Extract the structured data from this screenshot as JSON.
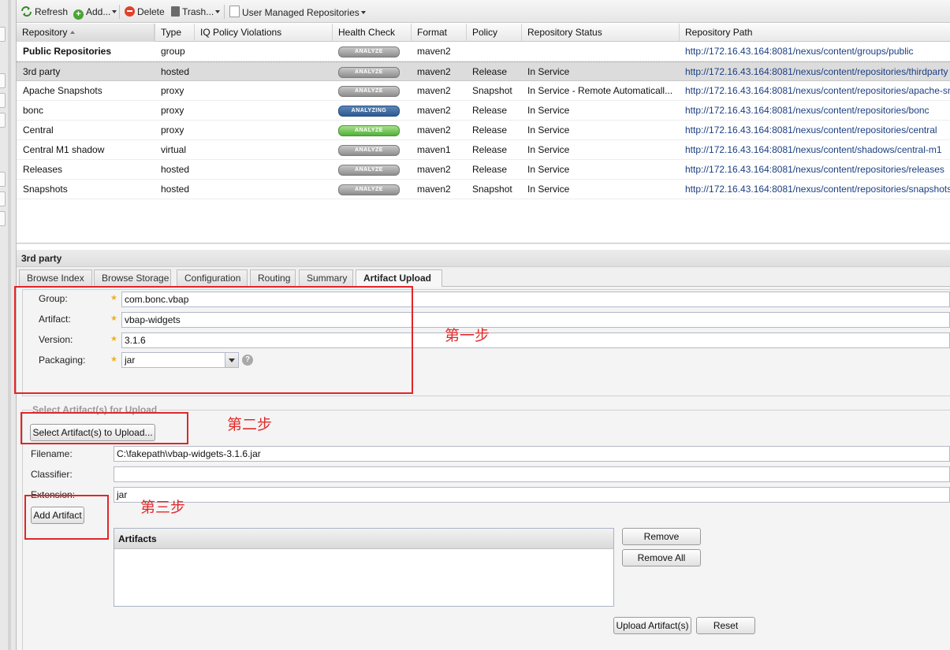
{
  "toolbar": {
    "refresh": "Refresh",
    "add": "Add...",
    "delete": "Delete",
    "trash": "Trash...",
    "filter": "User Managed Repositories"
  },
  "grid": {
    "columns": [
      "Repository",
      "Type",
      "IQ Policy Violations",
      "Health Check",
      "Format",
      "Policy",
      "Repository Status",
      "Repository Path"
    ],
    "rows": [
      {
        "name": "Public Repositories",
        "type": "group",
        "health": "ANALYZE",
        "health_style": "gray",
        "format": "maven2",
        "policy": "",
        "status": "",
        "path": "http://172.16.43.164:8081/nexus/content/groups/public"
      },
      {
        "name": "3rd party",
        "type": "hosted",
        "health": "ANALYZE",
        "health_style": "gray",
        "format": "maven2",
        "policy": "Release",
        "status": "In Service",
        "path": "http://172.16.43.164:8081/nexus/content/repositories/thirdparty"
      },
      {
        "name": "Apache Snapshots",
        "type": "proxy",
        "health": "ANALYZE",
        "health_style": "gray",
        "format": "maven2",
        "policy": "Snapshot",
        "status": "In Service - Remote Automaticall...",
        "path": "http://172.16.43.164:8081/nexus/content/repositories/apache-sn"
      },
      {
        "name": "bonc",
        "type": "proxy",
        "health": "ANALYZING",
        "health_style": "blue",
        "format": "maven2",
        "policy": "Release",
        "status": "In Service",
        "path": "http://172.16.43.164:8081/nexus/content/repositories/bonc"
      },
      {
        "name": "Central",
        "type": "proxy",
        "health": "ANALYZE",
        "health_style": "green",
        "format": "maven2",
        "policy": "Release",
        "status": "In Service",
        "path": "http://172.16.43.164:8081/nexus/content/repositories/central"
      },
      {
        "name": "Central M1 shadow",
        "type": "virtual",
        "health": "ANALYZE",
        "health_style": "gray",
        "format": "maven1",
        "policy": "Release",
        "status": "In Service",
        "path": "http://172.16.43.164:8081/nexus/content/shadows/central-m1"
      },
      {
        "name": "Releases",
        "type": "hosted",
        "health": "ANALYZE",
        "health_style": "gray",
        "format": "maven2",
        "policy": "Release",
        "status": "In Service",
        "path": "http://172.16.43.164:8081/nexus/content/repositories/releases"
      },
      {
        "name": "Snapshots",
        "type": "hosted",
        "health": "ANALYZE",
        "health_style": "gray",
        "format": "maven2",
        "policy": "Snapshot",
        "status": "In Service",
        "path": "http://172.16.43.164:8081/nexus/content/repositories/snapshots"
      }
    ]
  },
  "panel": {
    "title": "3rd party",
    "tabs": [
      "Browse Index",
      "Browse Storage",
      "Configuration",
      "Routing",
      "Summary",
      "Artifact Upload"
    ]
  },
  "form": {
    "group_label": "Group:",
    "group_value": "com.bonc.vbap",
    "artifact_label": "Artifact:",
    "artifact_value": "vbap-widgets",
    "version_label": "Version:",
    "version_value": "3.1.6",
    "packaging_label": "Packaging:",
    "packaging_value": "jar",
    "help": "?"
  },
  "upload": {
    "legend": "Select Artifact(s) for Upload",
    "select_button": "Select Artifact(s) to Upload...",
    "filename_label": "Filename:",
    "filename_value": "C:\\fakepath\\vbap-widgets-3.1.6.jar",
    "classifier_label": "Classifier:",
    "classifier_value": "",
    "extension_label": "Extension:",
    "extension_value": "jar",
    "add_button": "Add Artifact",
    "artifacts_header": "Artifacts",
    "remove_button": "Remove",
    "remove_all_button": "Remove All",
    "upload_button": "Upload Artifact(s)",
    "reset_button": "Reset"
  },
  "annotations": {
    "step1": "第一步",
    "step2": "第二步",
    "step3": "第三步",
    "color": "#e0262a"
  }
}
